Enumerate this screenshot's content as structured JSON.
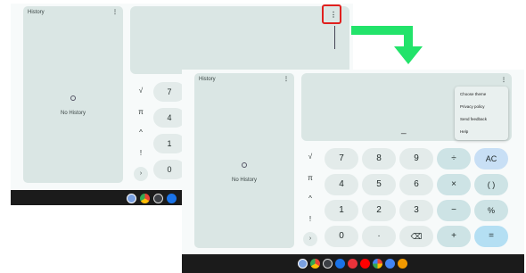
{
  "back_screen": {
    "history_title": "History",
    "menu_icon": "more-vert-icon",
    "no_history": "No History",
    "sci_keys": [
      "√",
      "π",
      "^",
      "!",
      "›"
    ],
    "partial_digits": [
      "7",
      "4",
      "1",
      "0"
    ]
  },
  "front_screen": {
    "history_title": "History",
    "menu_icon": "more-vert-icon",
    "no_history": "No History",
    "display_value": "_",
    "menu_items": [
      "Choose theme",
      "Privacy policy",
      "Send feedback",
      "Help"
    ],
    "sci_keys": [
      "√",
      "π",
      "^",
      "!",
      "›"
    ],
    "keypad": [
      [
        "7",
        "8",
        "9",
        "÷",
        "AC"
      ],
      [
        "4",
        "5",
        "6",
        "×",
        "( )"
      ],
      [
        "1",
        "2",
        "3",
        "−",
        "%"
      ],
      [
        "0",
        "·",
        "⌫",
        "+",
        "="
      ]
    ]
  },
  "shelf_icons": [
    "launcher-icon",
    "chrome-icon",
    "files-icon",
    "settings-icon",
    "calculator-icon",
    "youtube-icon",
    "photos-icon",
    "play-store-icon",
    "app-icon"
  ],
  "colors": {
    "highlight": "#e0201e",
    "arrow": "#22e36a",
    "history_panel": "#dae6e4",
    "equals_key": "#b4dff3",
    "ac_key": "#c8dff5"
  }
}
